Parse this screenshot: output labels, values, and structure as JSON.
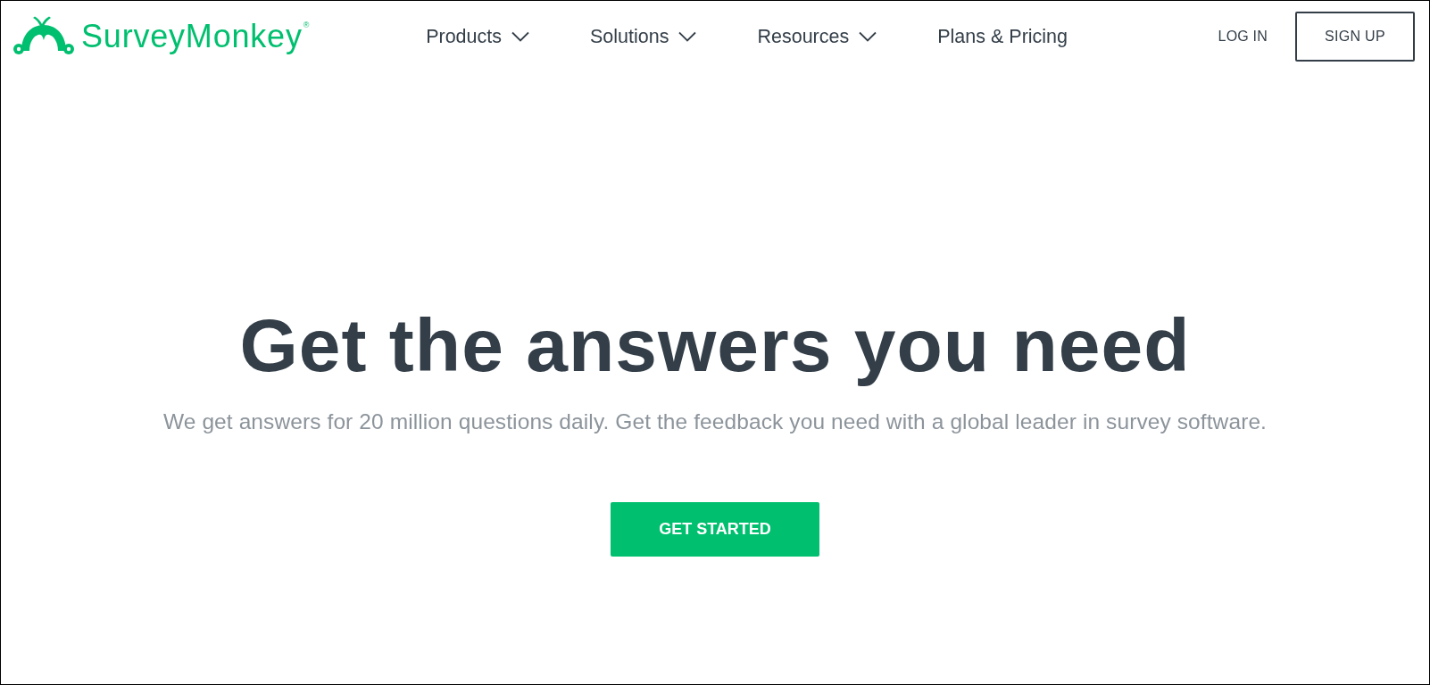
{
  "logo": {
    "text": "SurveyMonkey$^{®}$"
  },
  "nav": [
    {
      "label": "Products",
      "dropdown": true
    },
    {
      "label": "Solutions",
      "dropdown": true
    },
    {
      "label": "Resources",
      "dropdown": true
    },
    {
      "label": "Plans & Pricing",
      "dropdown": false
    }
  ],
  "login": {
    "label": "LOG IN"
  },
  "signup": {
    "label": "SIGN UP"
  },
  "hero": {
    "title": "Get the answers you need",
    "subtitle": "We get answers for 20 million questions daily. Get the feedback you need with a global leader in survey software.",
    "cta": "GET STARTED"
  }
}
